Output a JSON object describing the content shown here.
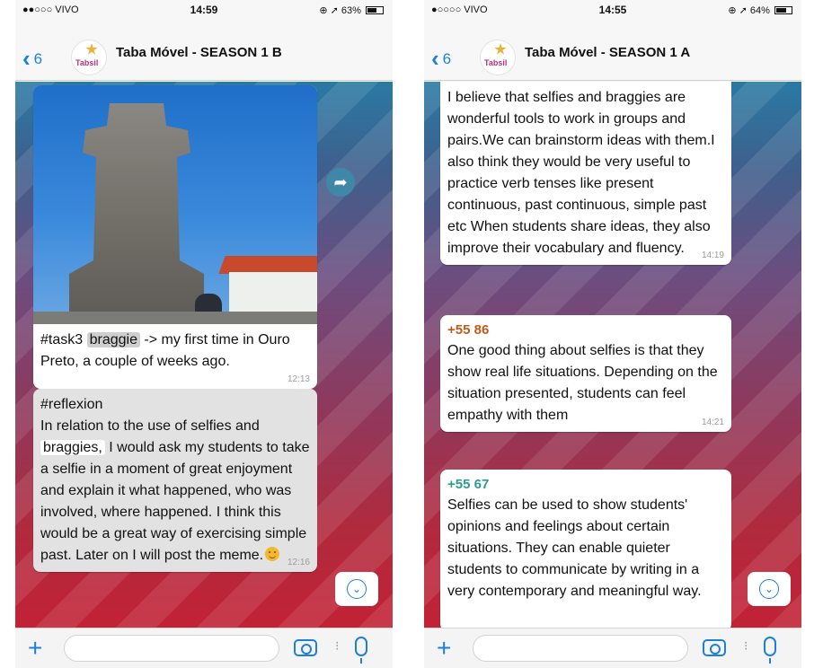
{
  "left": {
    "status": {
      "carrier": "●●○○○ VIVO",
      "time": "14:59",
      "right": "⊕ ➚ 63%",
      "battery_level": 0.63
    },
    "nav": {
      "back": "6",
      "title": "Taba Móvel - SEASON 1 B",
      "avatar_text": "Tabsil"
    },
    "messages": [
      {
        "hashtag": "#task3",
        "highlight": "braggie",
        "rest": "-> my first time in Ouro Preto, a couple of weeks ago.",
        "time": "12:13"
      },
      {
        "tag": "#reflexion",
        "pre": "In relation to the use of selfies and",
        "highlight": "braggies,",
        "post": "I would ask my students to take a selfie in a moment of great enjoyment and explain it what happened, who was involved, where happened. I think this would be a great way of exercising simple past. Later on I will post the meme.",
        "time": "12:16"
      }
    ]
  },
  "right": {
    "status": {
      "carrier": "●○○○○ VIVO",
      "time": "14:55",
      "right": "⊕ ➚ 64%",
      "battery_level": 0.64
    },
    "nav": {
      "back": "6",
      "title": "Taba Móvel - SEASON 1 A",
      "avatar_text": "Tabsil"
    },
    "messages": [
      {
        "sender": "",
        "text": "I believe that selfies and braggies are wonderful tools to work in groups and pairs.We can brainstorm ideas with them.I also think they would be very useful to practice verb tenses like present continuous, past continuous, simple past etc When students share ideas, they also improve their vocabulary and fluency.",
        "time": "14:19"
      },
      {
        "sender": "+55 86",
        "text": "One good thing about selfies is that they show real life situations. Depending on the situation presented, students can feel empathy with them",
        "time": "14:21"
      },
      {
        "sender": "+55 67",
        "text": "Selfies can be used to show students' opinions and feelings about certain situations. They can enable quieter students to communicate by writing in a very contemporary and meaningful way.",
        "time": ""
      }
    ]
  },
  "icons": {
    "back": "chevron-left-icon",
    "forward": "share-forward-icon",
    "scroll": "chevron-down-icon",
    "plus": "plus-icon",
    "camera": "camera-icon",
    "mic": "microphone-icon"
  },
  "colors": {
    "accent": "#1e7fd8",
    "sender_orange": "#c05a1c",
    "sender_teal": "#2a9d8f"
  }
}
